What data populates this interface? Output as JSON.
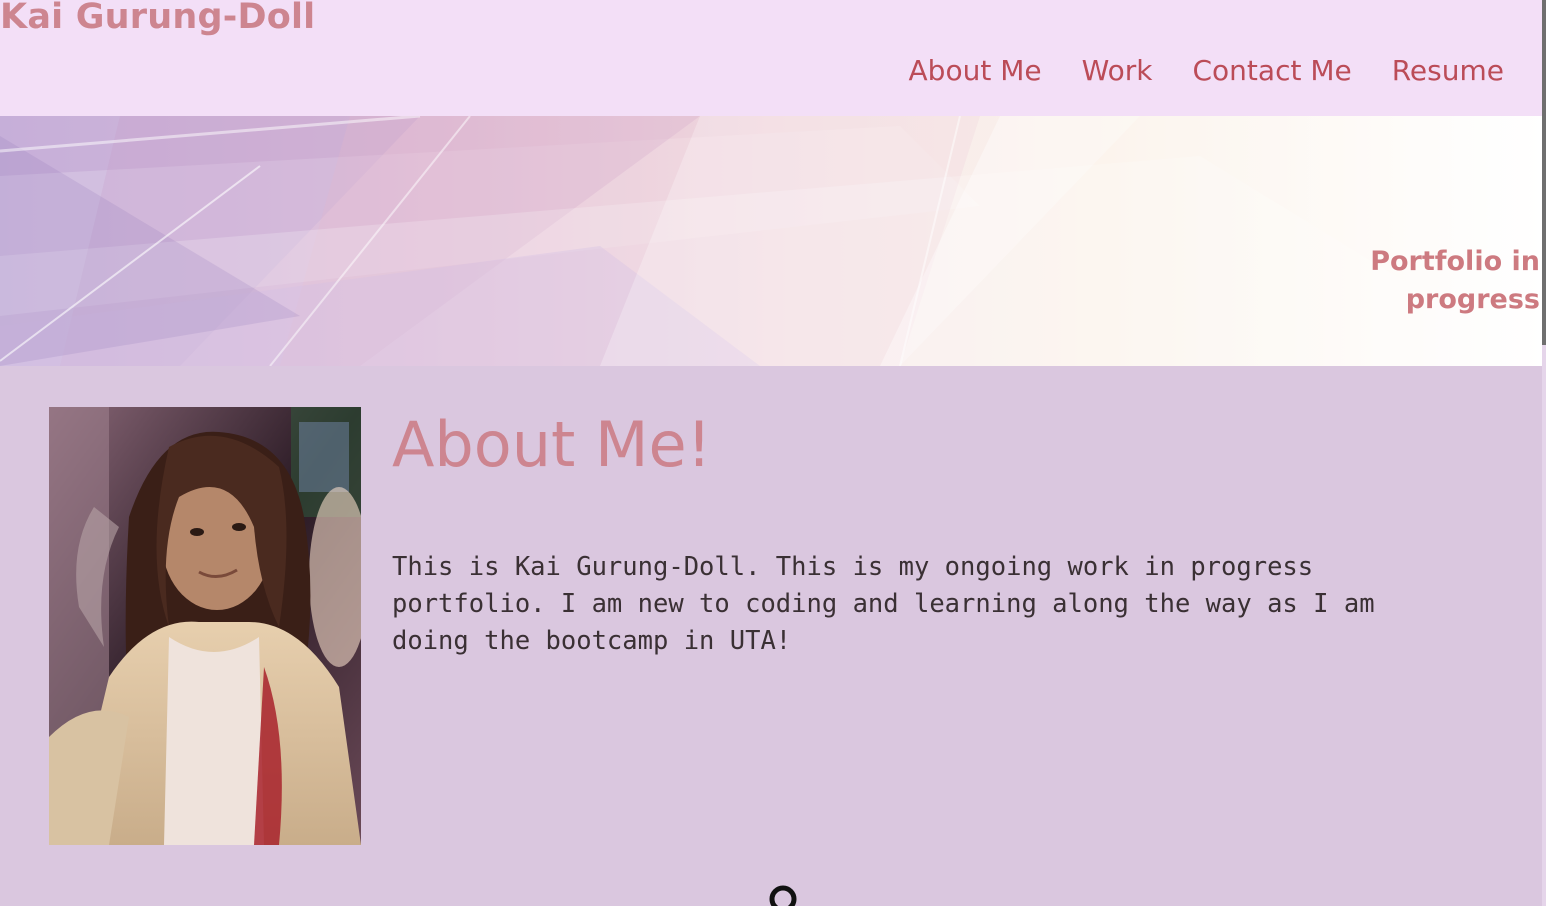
{
  "header": {
    "site_title": "Kai Gurung-Doll",
    "nav": [
      {
        "label": "About Me"
      },
      {
        "label": "Work"
      },
      {
        "label": "Contact Me"
      },
      {
        "label": "Resume"
      }
    ]
  },
  "banner": {
    "tagline": "Portfolio in progress"
  },
  "about": {
    "heading": "About Me!",
    "body": "This is Kai Gurung-Doll. This is my ongoing work in progress portfolio. I am new to coding and learning along the way as I am doing the bootcamp in UTA!"
  },
  "colors": {
    "header_bg": "#f3dff7",
    "page_bg": "#dac7df",
    "title_accent": "#cd8590",
    "nav_link": "#bb4c58",
    "body_text": "#3a3034"
  },
  "icons": {
    "bottom": "location-pin-icon"
  }
}
